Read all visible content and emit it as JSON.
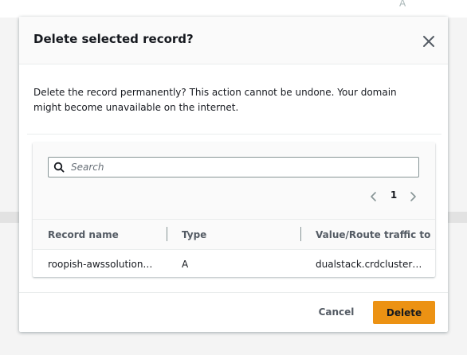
{
  "background": {
    "corner_letter": "A"
  },
  "modal": {
    "title": "Delete selected record?",
    "close_icon": "close-icon",
    "message": "Delete the record permanently? This action cannot be undone. Your domain might become unavailable on the internet.",
    "search": {
      "placeholder": "Search",
      "value": ""
    },
    "pagination": {
      "current_page": "1",
      "prev_icon": "chevron-left-icon",
      "next_icon": "chevron-right-icon"
    },
    "table": {
      "columns": [
        "Record name",
        "Type",
        "Value/Route traffic to"
      ],
      "rows": [
        {
          "record_name": "roopish-awssolution…",
          "type": "A",
          "value": "dualstack.crdcluster…"
        }
      ]
    },
    "footer": {
      "cancel_label": "Cancel",
      "delete_label": "Delete"
    }
  },
  "colors": {
    "primary_button": "#ec9213",
    "text": "#16191f",
    "muted_text": "#545b64",
    "border": "#eaeded"
  }
}
